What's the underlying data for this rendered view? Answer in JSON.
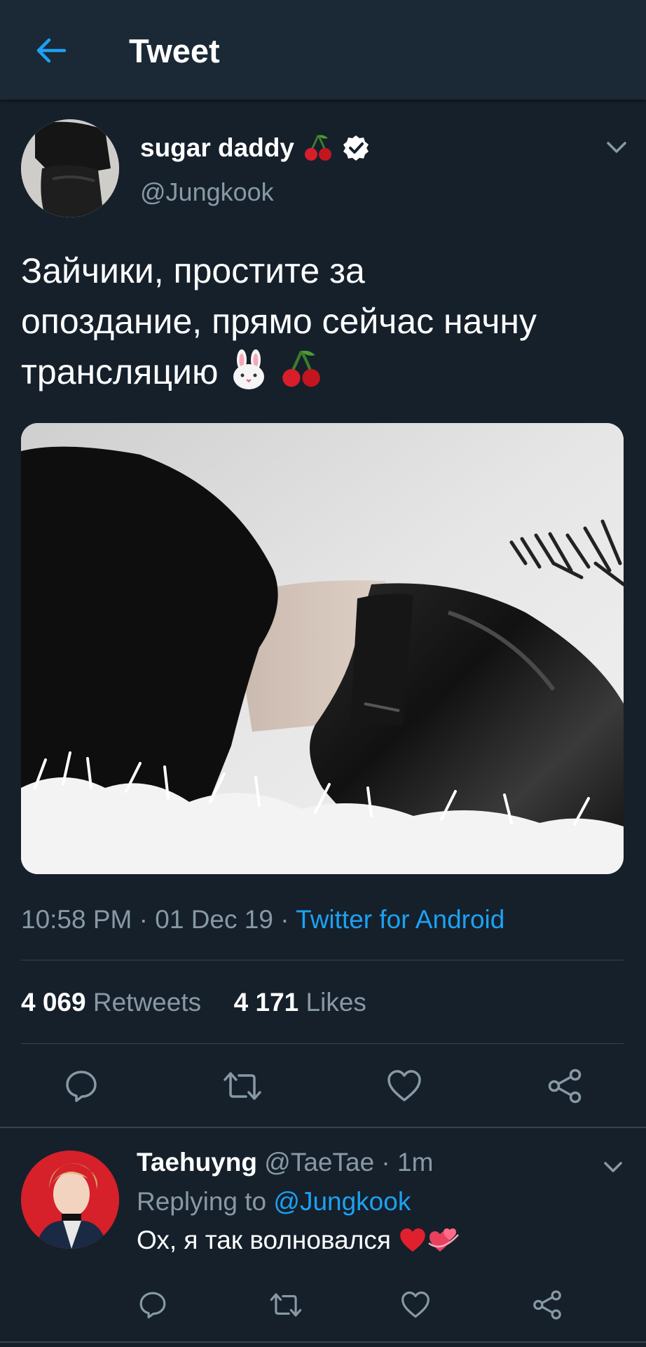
{
  "header": {
    "title": "Tweet"
  },
  "tweet": {
    "author_name": "sugar daddy",
    "handle": "@Jungkook",
    "text_line1": "Зайчики, простите за",
    "text_line2": "опоздание, прямо сейчас начну",
    "text_line3": "трансляцию",
    "time": "10:58 PM",
    "date": "01 Dec 19",
    "separator": " · ",
    "source": "Twitter for Android",
    "retweets_count": "4 069",
    "retweets_label": "Retweets",
    "likes_count": "4 171",
    "likes_label": "Likes"
  },
  "reply": {
    "author_name": "Taehuyng",
    "handle_time": "@TaeTae · 1m",
    "replying_prefix": "Replying to",
    "replying_mention": "@Jungkook",
    "text": "Ох, я так волновался"
  },
  "colors": {
    "background": "#15202b",
    "header": "#1b2836",
    "accent": "#1da1f2",
    "secondary_text": "#8899a6",
    "divider": "#38444d"
  },
  "icons": [
    "back-arrow-icon",
    "cherry-icon",
    "verified-badge-icon",
    "chevron-down-icon",
    "rabbit-face-icon",
    "reply-icon",
    "retweet-icon",
    "like-icon",
    "share-icon",
    "red-heart-icon",
    "revolving-hearts-icon"
  ]
}
